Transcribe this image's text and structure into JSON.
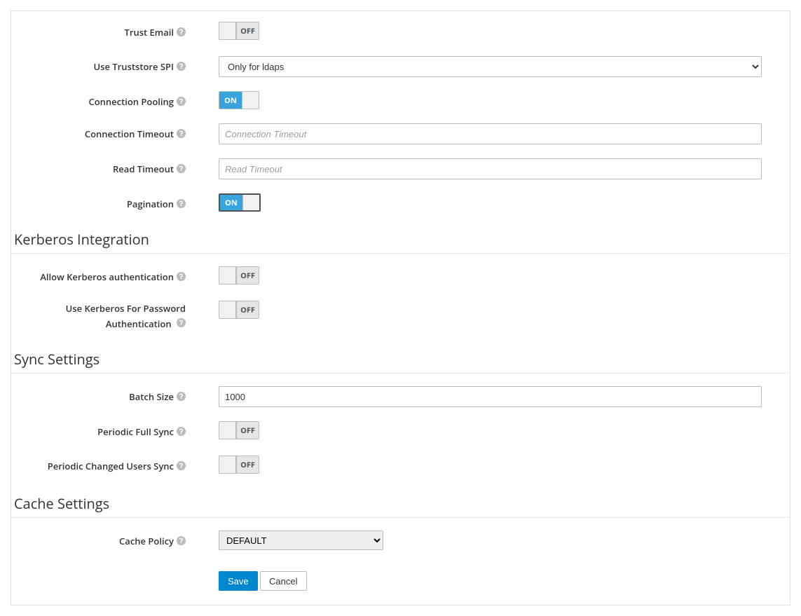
{
  "toggle_text": {
    "on": "ON",
    "off": "OFF"
  },
  "fields": {
    "trust_email": {
      "label": "Trust Email",
      "value": false
    },
    "use_truststore_spi": {
      "label": "Use Truststore SPI",
      "value": "Only for ldaps"
    },
    "connection_pooling": {
      "label": "Connection Pooling",
      "value": true
    },
    "connection_timeout": {
      "label": "Connection Timeout",
      "value": "",
      "placeholder": "Connection Timeout"
    },
    "read_timeout": {
      "label": "Read Timeout",
      "value": "",
      "placeholder": "Read Timeout"
    },
    "pagination": {
      "label": "Pagination",
      "value": true
    },
    "allow_kerberos": {
      "label": "Allow Kerberos authentication",
      "value": false
    },
    "kerberos_pw": {
      "label": "Use Kerberos For Password Authentication",
      "value": false
    },
    "batch_size": {
      "label": "Batch Size",
      "value": "1000"
    },
    "periodic_full_sync": {
      "label": "Periodic Full Sync",
      "value": false
    },
    "periodic_changed_sync": {
      "label": "Periodic Changed Users Sync",
      "value": false
    },
    "cache_policy": {
      "label": "Cache Policy",
      "value": "DEFAULT"
    }
  },
  "sections": {
    "kerberos": "Kerberos Integration",
    "sync": "Sync Settings",
    "cache": "Cache Settings"
  },
  "buttons": {
    "save": "Save",
    "cancel": "Cancel"
  }
}
